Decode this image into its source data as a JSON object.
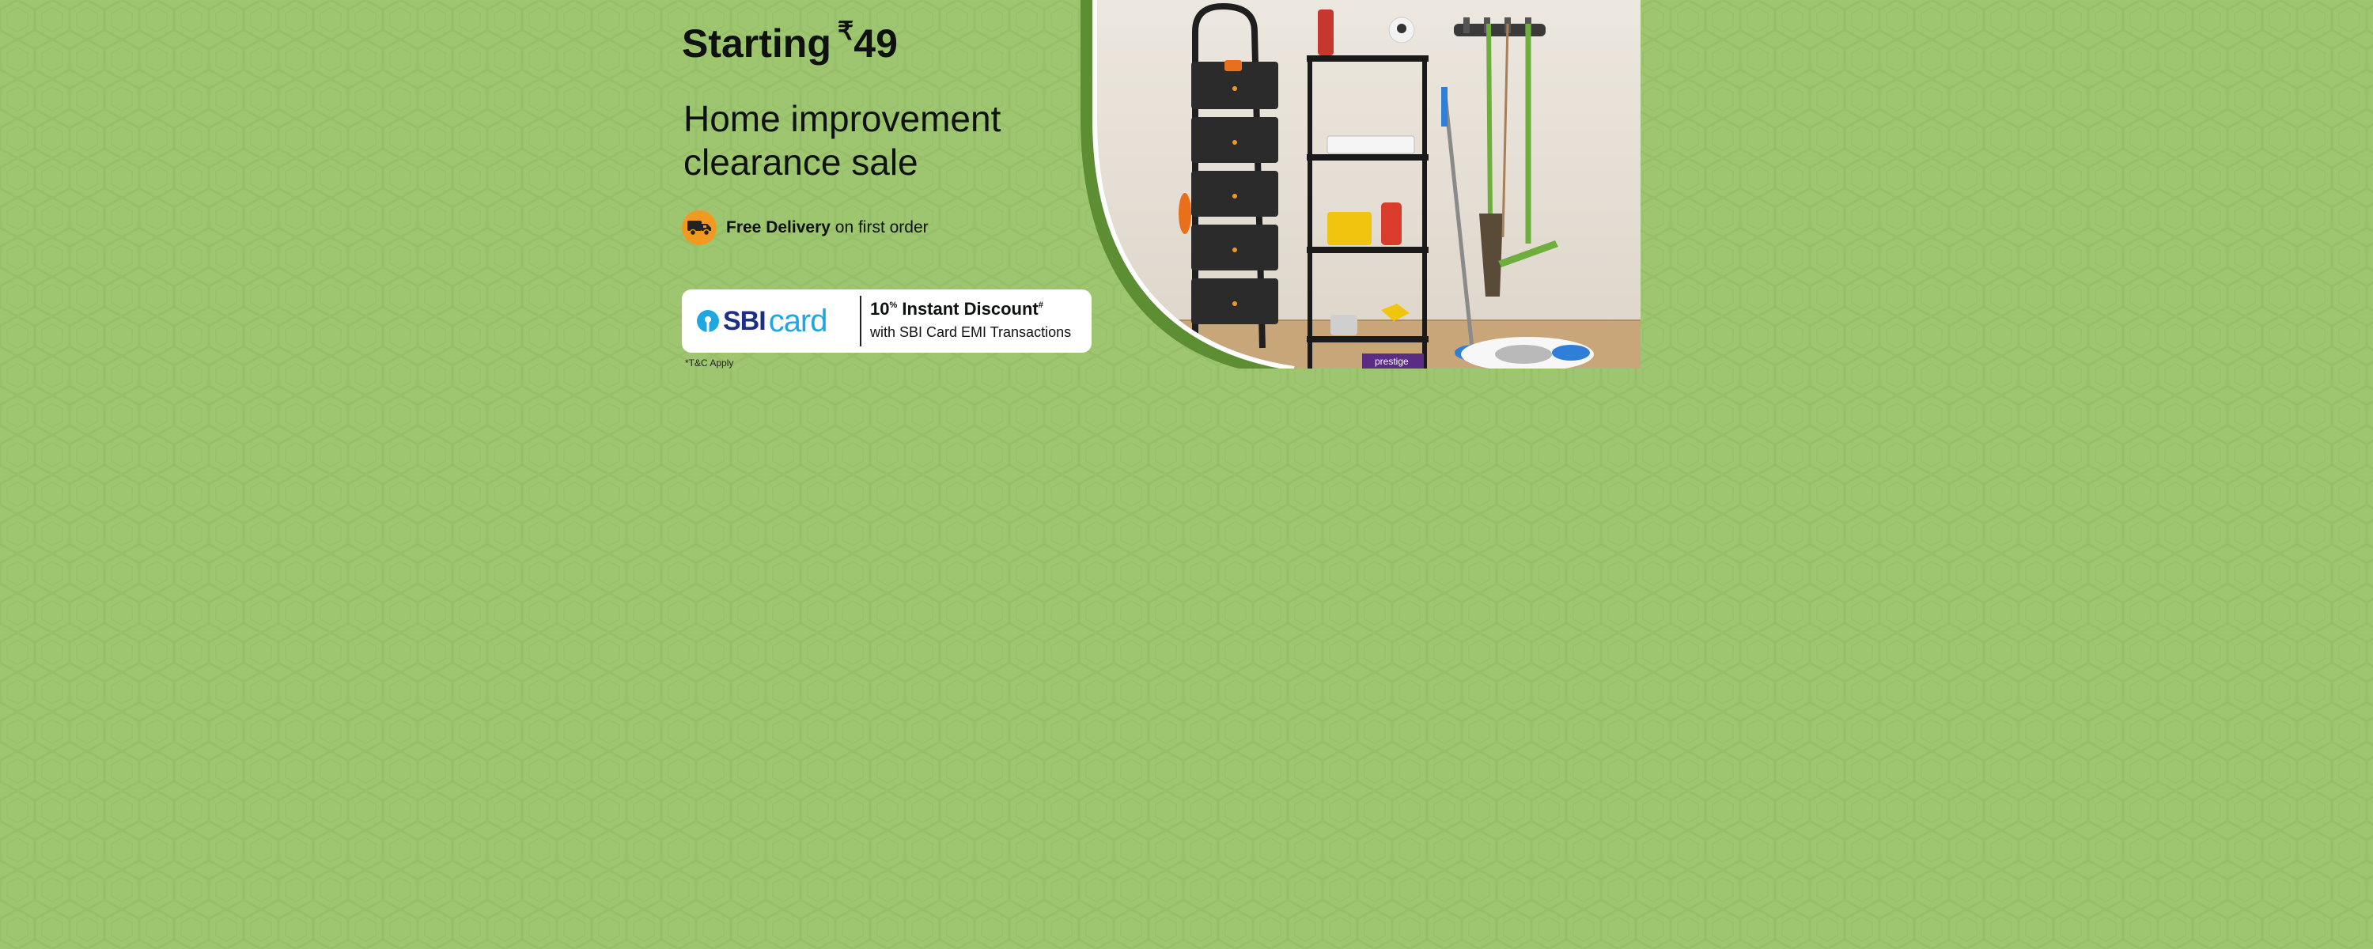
{
  "banner": {
    "starting_label": "Starting",
    "currency_symbol": "₹",
    "starting_price": "49",
    "headline_line1": "Home improvement",
    "headline_line2": "clearance sale",
    "delivery_bold": "Free Delivery",
    "delivery_rest": "on first order",
    "truck_icon": "delivery-truck-icon"
  },
  "offer": {
    "bank_wordmark": "SBI",
    "bank_card_word": "card",
    "discount_value": "10",
    "discount_percent_sup": "%",
    "discount_label": "Instant Discount",
    "discount_hash_sup": "#",
    "discount_subtext": "with SBI Card EMI Transactions",
    "terms": "*T&C Apply"
  },
  "product_image": {
    "items": [
      "folding-ladder",
      "storage-rack",
      "broom",
      "wiper",
      "mop",
      "mop-bucket",
      "security-camera",
      "power-strip",
      "glue-gun",
      "wall-hook-organizer",
      "toolbox"
    ],
    "bucket_label": "prestige"
  },
  "colors": {
    "background": "#9ec56f",
    "accent_green": "#5e8e34",
    "truck_badge": "#f29a1f",
    "sbi_navy": "#1d2e87",
    "sbi_blue": "#1fa7e0"
  }
}
